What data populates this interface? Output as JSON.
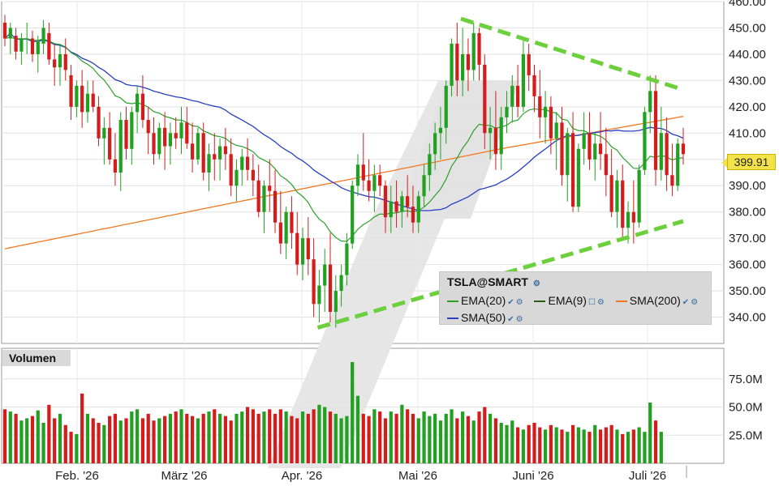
{
  "chart_data": {
    "type": "candlestick",
    "symbol": "TSLA@SMART",
    "last_price": "399.91",
    "price_axis": {
      "min": 330,
      "max": 460,
      "ticks": [
        "460.00",
        "450.00",
        "440.00",
        "430.00",
        "420.00",
        "410.00",
        "400.00",
        "390.00",
        "380.00",
        "370.00",
        "360.00",
        "350.00",
        "340.00"
      ]
    },
    "volume_axis": {
      "max_m": 95,
      "ticks": [
        "75.0M",
        "50.0M",
        "25.0M"
      ]
    },
    "x_labels": [
      "Feb. '26",
      "März '26",
      "Apr. '26",
      "Mai '26",
      "Juni '26",
      "Juli '26"
    ],
    "volume_panel_label": "Volumen",
    "legend": [
      {
        "name": "EMA(20)",
        "color": "#2ca02c"
      },
      {
        "name": "EMA(9)",
        "color": "#2e5a1c"
      },
      {
        "name": "SMA(200)",
        "color": "#f07820"
      },
      {
        "name": "SMA(50)",
        "color": "#2a3fc0"
      }
    ],
    "colors": {
      "up": "#22a022",
      "down": "#d41c1c",
      "trend": "#6ccf3c",
      "sma200": "#f07820",
      "sma50": "#2a3fc0",
      "ema20": "#2ca02c"
    },
    "trend_lines": [
      {
        "from": [
          "2026-05-22",
          453.5
        ],
        "to": [
          "2026-07-20",
          426.5
        ]
      },
      {
        "from": [
          "2026-04-14",
          336
        ],
        "to": [
          "2026-07-20",
          376.5
        ]
      }
    ],
    "candles": [
      [
        452,
        455,
        443,
        446
      ],
      [
        446,
        452,
        440,
        450
      ],
      [
        447,
        450,
        438,
        441
      ],
      [
        441,
        448,
        436,
        446
      ],
      [
        446,
        452,
        440,
        446
      ],
      [
        446,
        449,
        437,
        440
      ],
      [
        440,
        447,
        433,
        445
      ],
      [
        444,
        453,
        440,
        450
      ],
      [
        448,
        452,
        436,
        438
      ],
      [
        438,
        444,
        428,
        435
      ],
      [
        435,
        444,
        428,
        440
      ],
      [
        440,
        446,
        430,
        434
      ],
      [
        432,
        436,
        415,
        420
      ],
      [
        420,
        430,
        416,
        428
      ],
      [
        428,
        434,
        412,
        418
      ],
      [
        418,
        430,
        414,
        425
      ],
      [
        425,
        430,
        418,
        420
      ],
      [
        420,
        424,
        405,
        408
      ],
      [
        408,
        416,
        398,
        412
      ],
      [
        412,
        418,
        398,
        400
      ],
      [
        400,
        410,
        390,
        395
      ],
      [
        395,
        418,
        388,
        415
      ],
      [
        415,
        420,
        400,
        404
      ],
      [
        404,
        420,
        398,
        418
      ],
      [
        418,
        428,
        410,
        425
      ],
      [
        425,
        432,
        412,
        415
      ],
      [
        415,
        420,
        402,
        410
      ],
      [
        410,
        416,
        398,
        402
      ],
      [
        402,
        414,
        400,
        412
      ],
      [
        412,
        418,
        396,
        405
      ],
      [
        405,
        414,
        398,
        410
      ],
      [
        410,
        416,
        404,
        408
      ],
      [
        408,
        420,
        402,
        414
      ],
      [
        414,
        420,
        404,
        406
      ],
      [
        406,
        414,
        395,
        400
      ],
      [
        400,
        412,
        398,
        410
      ],
      [
        410,
        414,
        392,
        395
      ],
      [
        395,
        406,
        388,
        402
      ],
      [
        402,
        410,
        392,
        400
      ],
      [
        400,
        408,
        392,
        405
      ],
      [
        405,
        412,
        396,
        402
      ],
      [
        402,
        408,
        386,
        390
      ],
      [
        390,
        400,
        384,
        396
      ],
      [
        396,
        404,
        390,
        401
      ],
      [
        401,
        408,
        392,
        396
      ],
      [
        396,
        402,
        386,
        392
      ],
      [
        392,
        398,
        378,
        380
      ],
      [
        380,
        392,
        372,
        390
      ],
      [
        390,
        400,
        380,
        388
      ],
      [
        388,
        396,
        372,
        376
      ],
      [
        376,
        388,
        364,
        368
      ],
      [
        368,
        382,
        362,
        380
      ],
      [
        380,
        386,
        366,
        372
      ],
      [
        372,
        380,
        356,
        360
      ],
      [
        360,
        374,
        354,
        370
      ],
      [
        370,
        378,
        356,
        362
      ],
      [
        362,
        370,
        340,
        345
      ],
      [
        345,
        358,
        338,
        352
      ],
      [
        352,
        366,
        342,
        360
      ],
      [
        360,
        372,
        338,
        342
      ],
      [
        342,
        356,
        336,
        350
      ],
      [
        350,
        360,
        344,
        356
      ],
      [
        356,
        372,
        352,
        368
      ],
      [
        368,
        392,
        366,
        390
      ],
      [
        390,
        402,
        386,
        398
      ],
      [
        398,
        410,
        388,
        392
      ],
      [
        392,
        400,
        384,
        388
      ],
      [
        388,
        398,
        380,
        394
      ],
      [
        394,
        398,
        386,
        390
      ],
      [
        390,
        392,
        372,
        378
      ],
      [
        378,
        390,
        372,
        384
      ],
      [
        384,
        392,
        374,
        380
      ],
      [
        380,
        388,
        374,
        386
      ],
      [
        386,
        394,
        378,
        382
      ],
      [
        382,
        390,
        372,
        376
      ],
      [
        376,
        388,
        372,
        386
      ],
      [
        386,
        398,
        382,
        394
      ],
      [
        394,
        406,
        388,
        402
      ],
      [
        402,
        414,
        396,
        410
      ],
      [
        410,
        420,
        400,
        412
      ],
      [
        412,
        430,
        406,
        428
      ],
      [
        428,
        446,
        424,
        444
      ],
      [
        444,
        452,
        424,
        430
      ],
      [
        430,
        450,
        424,
        440
      ],
      [
        440,
        446,
        426,
        434
      ],
      [
        434,
        452,
        430,
        448
      ],
      [
        448,
        450,
        430,
        436
      ],
      [
        436,
        440,
        404,
        410
      ],
      [
        410,
        420,
        400,
        412
      ],
      [
        412,
        426,
        396,
        402
      ],
      [
        402,
        420,
        396,
        416
      ],
      [
        416,
        426,
        410,
        420
      ],
      [
        420,
        432,
        414,
        428
      ],
      [
        428,
        436,
        416,
        420
      ],
      [
        420,
        446,
        418,
        440
      ],
      [
        440,
        444,
        426,
        432
      ],
      [
        432,
        436,
        418,
        424
      ],
      [
        424,
        434,
        408,
        416
      ],
      [
        416,
        426,
        406,
        420
      ],
      [
        420,
        424,
        402,
        408
      ],
      [
        408,
        418,
        396,
        414
      ],
      [
        414,
        420,
        390,
        394
      ],
      [
        394,
        412,
        384,
        410
      ],
      [
        410,
        418,
        380,
        382
      ],
      [
        382,
        406,
        380,
        404
      ],
      [
        404,
        418,
        398,
        410
      ],
      [
        410,
        418,
        396,
        400
      ],
      [
        400,
        410,
        392,
        406
      ],
      [
        406,
        418,
        396,
        402
      ],
      [
        402,
        412,
        386,
        394
      ],
      [
        394,
        404,
        378,
        380
      ],
      [
        380,
        396,
        374,
        392
      ],
      [
        392,
        398,
        370,
        374
      ],
      [
        374,
        384,
        368,
        380
      ],
      [
        380,
        392,
        368,
        376
      ],
      [
        376,
        398,
        374,
        396
      ],
      [
        396,
        420,
        394,
        418
      ],
      [
        418,
        432,
        410,
        426
      ],
      [
        426,
        432,
        390,
        396
      ],
      [
        396,
        420,
        392,
        410
      ],
      [
        410,
        416,
        388,
        394
      ],
      [
        394,
        406,
        386,
        390
      ],
      [
        390,
        408,
        388,
        406
      ],
      [
        406,
        412,
        398,
        402
      ]
    ],
    "volumes_m": [
      48,
      46,
      44,
      38,
      40,
      42,
      47,
      36,
      52,
      40,
      44,
      34,
      28,
      26,
      62,
      44,
      40,
      36,
      34,
      42,
      44,
      38,
      40,
      46,
      48,
      40,
      44,
      38,
      40,
      42,
      44,
      46,
      48,
      44,
      42,
      40,
      44,
      46,
      48,
      44,
      42,
      38,
      44,
      46,
      50,
      48,
      44,
      46,
      48,
      44,
      48,
      46,
      42,
      40,
      46,
      44,
      48,
      52,
      50,
      46,
      44,
      40,
      42,
      90,
      60,
      44,
      42,
      48,
      46,
      40,
      46,
      44,
      52,
      48,
      44,
      40,
      46,
      42,
      44,
      38,
      44,
      48,
      40,
      46,
      42,
      38,
      46,
      50,
      44,
      40,
      36,
      34,
      38,
      32,
      30,
      34,
      36,
      32,
      30,
      34,
      32,
      30,
      28,
      34,
      32,
      30,
      28,
      34,
      30,
      32,
      34,
      30,
      26,
      28,
      30,
      32,
      28,
      54,
      38,
      28
    ]
  }
}
